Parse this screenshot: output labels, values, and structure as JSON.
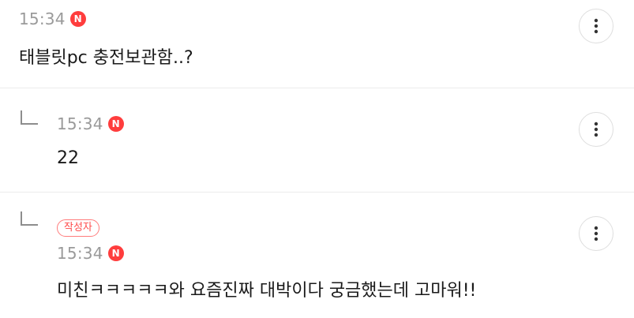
{
  "comments": [
    {
      "time": "15:34",
      "new_badge": "N",
      "text": "태블릿pc 충전보관함..?",
      "more_icon": "more-vertical-icon"
    },
    {
      "time": "15:34",
      "new_badge": "N",
      "text": "22",
      "reply_icon": "reply-arrow-icon",
      "more_icon": "more-vertical-icon"
    },
    {
      "author_badge": "작성자",
      "time": "15:34",
      "new_badge": "N",
      "text": "미친ㅋㅋㅋㅋㅋ와 요즘진짜 대박이다 궁금했는데 고마워!!",
      "reply_icon": "reply-arrow-icon",
      "more_icon": "more-vertical-icon"
    }
  ],
  "colors": {
    "new_badge_bg": "#ff3d3d",
    "author_badge": "#ff4a4a",
    "time_text": "#9a9a9a",
    "divider": "#ececec"
  }
}
